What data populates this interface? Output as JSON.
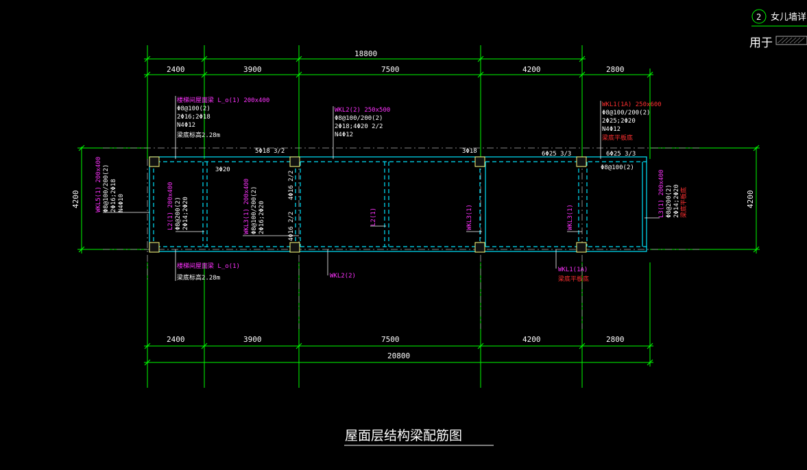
{
  "header": {
    "detail_number": "2",
    "detail_title": "女儿墙详图",
    "usage_label": "用于"
  },
  "drawing_title": "屋面层结构梁配筋图",
  "dimensions": {
    "top_total": "18800",
    "top_spans": [
      "2400",
      "3900",
      "7500",
      "4200",
      "2800"
    ],
    "bottom_spans": [
      "2400",
      "3900",
      "7500",
      "4200",
      "2800"
    ],
    "bottom_total": "20800",
    "left_height": "4200",
    "right_height": "4200"
  },
  "annotations": {
    "b1_title": "楼梯间屋面梁 L_o(1) 200x400",
    "b1_line1": "Φ8@100(2)",
    "b1_line2": "2Φ16;2Φ18",
    "b1_line3": "N4Φ12",
    "b1_line4": "梁底标高2.28m",
    "wkl2_title": "WKL2(2) 250x500",
    "wkl2_line1": "Φ8@100/200(2)",
    "wkl2_line2": "2Φ18;4Φ20 2/2",
    "wkl2_line3": "N4Φ12",
    "wkl1_title": "WKL1(1A) 250x600",
    "wkl1_line1": "Φ8@100/200(2)",
    "wkl1_line2": "2Φ25;2Φ20",
    "wkl1_line3": "N4Φ12",
    "wkl1_line4": "梁底平板底",
    "top_bar1": "5Φ18 3/2",
    "top_bar2": "3Φ18",
    "top_bar3": "6Φ25 3/3",
    "top_bar4": "6Φ25 3/3",
    "stirrup_right": "Φ8@100(2)",
    "bar_3_20": "3Φ20",
    "wkl5_title": "WKL5(1) 200x400",
    "wkl5_line1": "Φ8@100/200(2)",
    "wkl5_line2": "2Φ16;2Φ18",
    "wkl5_line3": "N4Φ10",
    "l2_title": "L2(1) 200x400",
    "l2_line1": "Φ8@200(2)",
    "l2_line2": "2Φ14;2Φ20",
    "wkl3_title": "WKL3(1) 200x400",
    "wkl3_line1": "Φ8@100/200(2)",
    "wkl3_line2": "2Φ16;2Φ20",
    "side_bar1": "4Φ16 2/2",
    "side_bar2": "4Φ16 2/2",
    "l2_mid": "L2(1)",
    "wkl3_mid1": "WKL3(1)",
    "wkl3_mid2": "WKL3(1)",
    "l3_title": "L3(1) 200x400",
    "l3_line1": "Φ8@200(2)",
    "l3_line2": "2Φ14;2Φ20",
    "l3_line3": "梁底平板底",
    "b2_title": "楼梯间屋面梁 L_o(1)",
    "b2_line1": "梁底标高2.28m",
    "wkl2_bottom": "WKL2(2)",
    "wkl1_bottom": "WKL1(1A)",
    "wkl1_bottom_note": "梁底平板底"
  },
  "colors": {
    "background": "#000000",
    "dimension": "#00ff00",
    "beam": "#00e5ff",
    "column": "#ffff80",
    "magenta": "#ff33ff",
    "red": "#ff3030"
  }
}
